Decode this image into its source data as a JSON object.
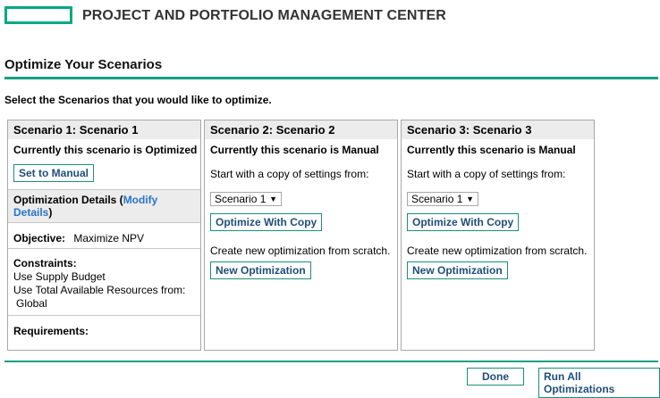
{
  "header": {
    "app_title": "PROJECT AND PORTFOLIO MANAGEMENT CENTER"
  },
  "page": {
    "title": "Optimize Your Scenarios",
    "instructions": "Select the Scenarios that you would like to optimize."
  },
  "scenarios": [
    {
      "title": "Scenario 1: Scenario 1",
      "status": "Currently this scenario is Optimized",
      "button": "Set to Manual",
      "details_prefix": "Optimization Details (",
      "details_link": "Modify Details",
      "details_suffix": ")",
      "objective_label": "Objective:",
      "objective_value": "Maximize NPV",
      "constraints_label": "Constraints:",
      "constraint_1": "Use Supply Budget",
      "constraint_2": "Use Total Available Resources from:",
      "constraint_2_value": "Global",
      "requirements_label": "Requirements:"
    },
    {
      "title": "Scenario 2: Scenario 2",
      "status": "Currently this scenario is Manual",
      "copy_label": "Start with a copy of settings from:",
      "copy_select": "Scenario 1",
      "copy_button": "Optimize With Copy",
      "scratch_label": "Create new optimization from scratch.",
      "scratch_button": "New Optimization"
    },
    {
      "title": "Scenario 3: Scenario 3",
      "status": "Currently this scenario is Manual",
      "copy_label": "Start with a copy of settings from:",
      "copy_select": "Scenario 1",
      "copy_button": "Optimize With Copy",
      "scratch_label": "Create new optimization from scratch.",
      "scratch_button": "New Optimization"
    }
  ],
  "footer": {
    "done": "Done",
    "run_all": "Run All Optimizations"
  },
  "colors": {
    "accent": "#01a982",
    "rule": "#15a082",
    "link": "#2a74c9",
    "button_text": "#1f4e79"
  },
  "icons": {
    "select_arrow": "chevron-down-icon"
  }
}
